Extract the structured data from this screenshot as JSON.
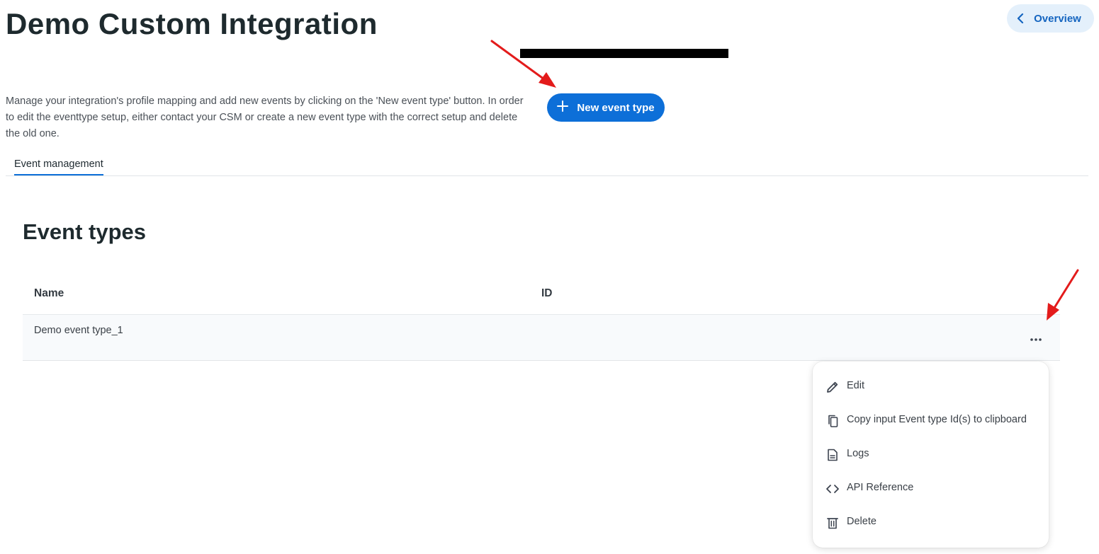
{
  "header": {
    "title": "Demo Custom Integration",
    "overview_label": "Overview"
  },
  "intro": {
    "description": "Manage your integration's profile mapping and add new events by clicking on the 'New event type' button. In order to edit the eventtype setup, either contact your CSM or create a new event type with the correct setup and delete the old one.",
    "new_event_label": "New event type"
  },
  "tabs": [
    {
      "label": "Event management",
      "active": true
    }
  ],
  "section": {
    "title": "Event types"
  },
  "table": {
    "columns": [
      "Name",
      "ID"
    ],
    "rows": [
      {
        "name": "Demo event type_1",
        "id": ""
      }
    ]
  },
  "row_menu": {
    "items": [
      {
        "label": "Edit",
        "icon": "pencil-icon"
      },
      {
        "label": "Copy input Event type Id(s) to clipboard",
        "icon": "copy-icon"
      },
      {
        "label": "Logs",
        "icon": "document-icon"
      },
      {
        "label": "API Reference",
        "icon": "code-icon"
      },
      {
        "label": "Delete",
        "icon": "trash-icon"
      }
    ]
  },
  "colors": {
    "primary": "#0d6fd8",
    "overview_bg": "#e4f0fb",
    "annotation_arrow": "#e31b1b"
  }
}
